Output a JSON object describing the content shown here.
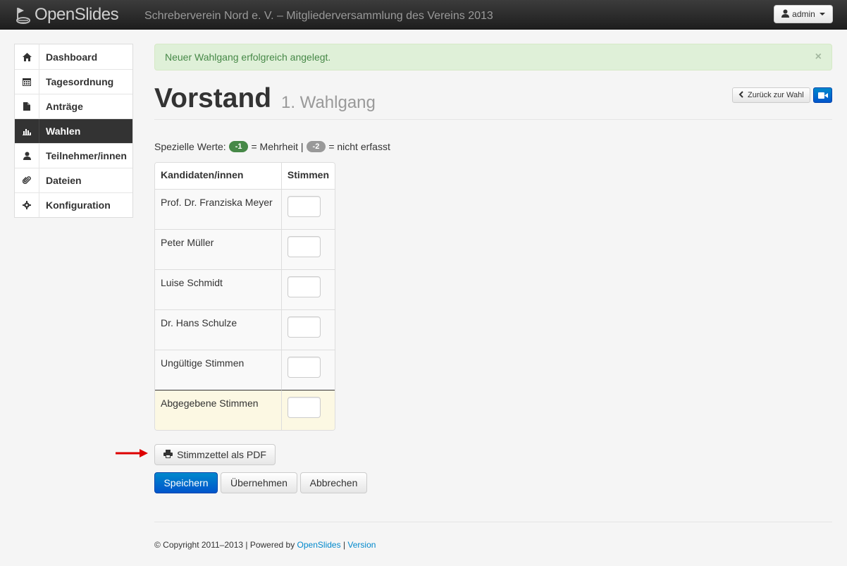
{
  "app": {
    "brand": "OpenSlides",
    "event_title": "Schreberverein Nord e. V. – Mitgliederversammlung des Vereins 2013",
    "user_label": "admin"
  },
  "sidebar": {
    "items": [
      {
        "label": "Dashboard",
        "icon": "home-icon",
        "active": false
      },
      {
        "label": "Tagesordnung",
        "icon": "calendar-icon",
        "active": false
      },
      {
        "label": "Anträge",
        "icon": "file-icon",
        "active": false
      },
      {
        "label": "Wahlen",
        "icon": "bar-chart-icon",
        "active": true
      },
      {
        "label": "Teilnehmer/innen",
        "icon": "user-icon",
        "active": false
      },
      {
        "label": "Dateien",
        "icon": "paperclip-icon",
        "active": false
      },
      {
        "label": "Konfiguration",
        "icon": "gear-icon",
        "active": false
      }
    ]
  },
  "alert": {
    "message": "Neuer Wahlgang erfolgreich angelegt.",
    "close": "×"
  },
  "header": {
    "title": "Vorstand",
    "subtitle": "1. Wahlgang",
    "back_label": "Zurück zur Wahl"
  },
  "special_values": {
    "prefix": "Spezielle Werte:",
    "majority_badge": "-1",
    "majority_text": "= Mehrheit |",
    "not_recorded_badge": "-2",
    "not_recorded_text": "= nicht erfasst"
  },
  "table": {
    "headers": [
      "Kandidaten/innen",
      "Stimmen"
    ],
    "rows": [
      {
        "name": "Prof. Dr. Franziska Meyer",
        "value": ""
      },
      {
        "name": "Peter Müller",
        "value": ""
      },
      {
        "name": "Luise Schmidt",
        "value": ""
      },
      {
        "name": "Dr. Hans Schulze",
        "value": ""
      },
      {
        "name": "Ungültige Stimmen",
        "value": ""
      },
      {
        "name": "Abgegebene Stimmen",
        "value": ""
      }
    ]
  },
  "actions": {
    "pdf_label": "Stimmzettel als PDF",
    "save_label": "Speichern",
    "apply_label": "Übernehmen",
    "cancel_label": "Abbrechen"
  },
  "footer": {
    "copyright": "© Copyright 2011–2013 | Powered by",
    "powered_link": "OpenSlides",
    "separator": "|",
    "version_link": "Version"
  },
  "colors": {
    "accent": "#0088cc",
    "success_bg": "#dff0d8",
    "success_text": "#468847",
    "arrow": "#dd0000"
  }
}
